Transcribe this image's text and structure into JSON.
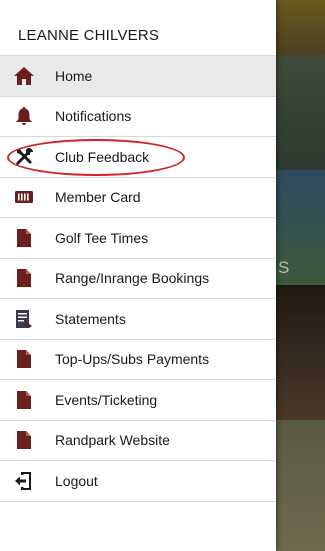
{
  "user": {
    "name": "LEANNE CHILVERS"
  },
  "background": {
    "partial_text": "S"
  },
  "menu": {
    "items": [
      {
        "label": "Home",
        "icon": "home-icon",
        "active": true
      },
      {
        "label": "Notifications",
        "icon": "bell-icon"
      },
      {
        "label": "Club Feedback",
        "icon": "tools-icon",
        "highlighted": true
      },
      {
        "label": "Member Card",
        "icon": "card-icon"
      },
      {
        "label": "Golf Tee Times",
        "icon": "document-icon"
      },
      {
        "label": "Range/Inrange Bookings",
        "icon": "document-icon"
      },
      {
        "label": "Statements",
        "icon": "statement-icon"
      },
      {
        "label": "Top-Ups/Subs Payments",
        "icon": "document-icon"
      },
      {
        "label": "Events/Ticketing",
        "icon": "document-icon"
      },
      {
        "label": "Randpark Website",
        "icon": "document-icon"
      },
      {
        "label": "Logout",
        "icon": "logout-icon"
      }
    ]
  },
  "colors": {
    "icon": "#6b1f1f",
    "highlight_ring": "#d0232a"
  }
}
